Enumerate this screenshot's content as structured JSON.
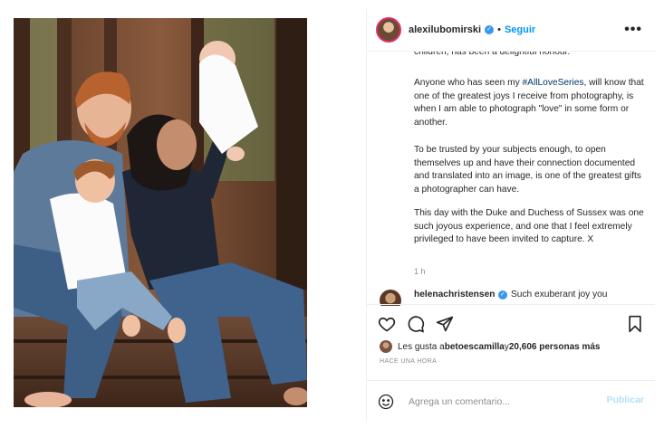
{
  "header": {
    "username": "alexilubomirski",
    "verified_icon": "verified-badge-icon",
    "dot": "•",
    "follow_label": "Seguir",
    "more_icon": "more-options-icon"
  },
  "caption": {
    "cut_text": "children, has been a delightful honour.",
    "p1_before": "Anyone who has seen my ",
    "p1_hashtag": "#AllLoveSeries",
    "p1_after": ", will know that one of the greatest joys I receive from photography, is when I am able to photograph \"love\" in some form or another.",
    "p2": "To be trusted by your subjects enough, to open themselves up and have their connection documented and translated into an image, is one of the greatest gifts a photographer can have.",
    "p3": "This day with the Duke and Duchess of Sussex was one such joyous experience, and one that I feel extremely privileged to have been invited to capture. X",
    "time": "1 h"
  },
  "comment": {
    "user": "helenachristensen",
    "text": "Such exuberant joy you"
  },
  "actions": {
    "icons": [
      "heart-icon",
      "comment-icon",
      "share-icon",
      "bookmark-icon"
    ]
  },
  "likes": {
    "prefix": "Les gusta a ",
    "user": "betoescamilla",
    "mid": " y ",
    "count": "20,606 personas más"
  },
  "posted": "HACE UNA HORA",
  "comment_box": {
    "emoji_icon": "emoji-icon",
    "placeholder": "Agrega un comentario...",
    "publish_label": "Publicar"
  },
  "colors": {
    "accent": "#0095f6",
    "verified": "#3897f0",
    "publish_disabled": "#b2dffc",
    "muted": "#8e8e8e"
  }
}
